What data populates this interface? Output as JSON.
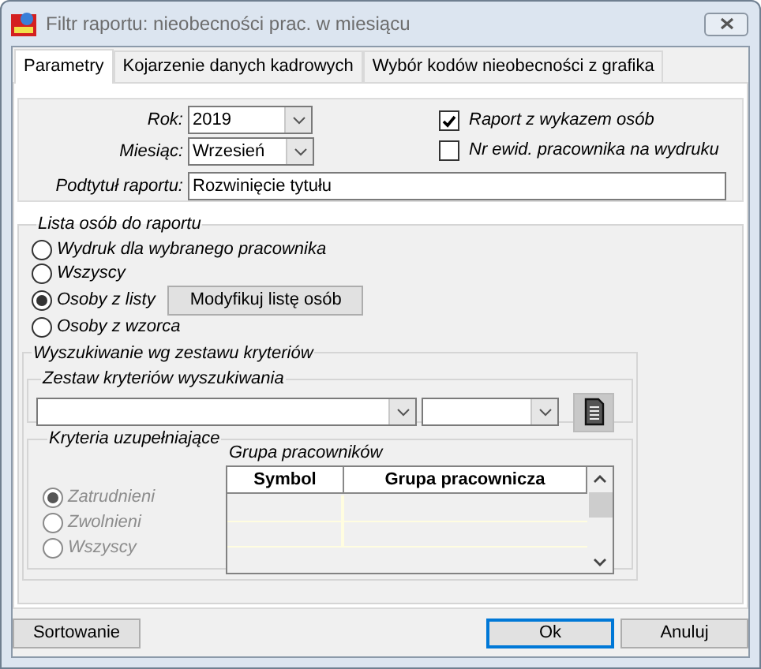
{
  "window": {
    "title": "Filtr raportu: nieobecności prac. w miesiącu"
  },
  "tabs": [
    {
      "label": "Parametry",
      "selected": true
    },
    {
      "label": "Kojarzenie danych kadrowych",
      "selected": false
    },
    {
      "label": "Wybór kodów nieobecności z grafika",
      "selected": false
    }
  ],
  "form": {
    "combos": [
      {
        "label": "Rok:",
        "value": "2019"
      },
      {
        "label": "Miesiąc:",
        "value": "Wrzesień"
      }
    ],
    "subtitle": {
      "label": "Podtytuł raportu:",
      "value": "Rozwinięcie tytułu"
    }
  },
  "options": [
    {
      "label": "Raport z wykazem osób",
      "checked": true
    },
    {
      "label": "Nr ewid. pracownika na wydruku",
      "checked": false
    }
  ],
  "person_list": {
    "title": "Lista osób do raportu",
    "choices": [
      {
        "label": "Wydruk dla wybranego pracownika",
        "selected": false
      },
      {
        "label": "Wszyscy",
        "selected": false
      },
      {
        "label": "Osoby z listy",
        "selected": true
      },
      {
        "label": "Osoby z wzorca",
        "selected": false
      }
    ],
    "modify_button": "Modyfikuj listę osób"
  },
  "search": {
    "title": "Wyszukiwanie wg zestawu kryteriów",
    "set_title": "Zestaw kryteriów wyszukiwania"
  },
  "supplementary": {
    "title": "Kryteria uzupełniające",
    "choices": [
      {
        "label": "Zatrudnieni",
        "selected": true,
        "disabled": true
      },
      {
        "label": "Zwolnieni",
        "selected": false,
        "disabled": true
      },
      {
        "label": "Wszyscy",
        "selected": false,
        "disabled": true
      }
    ],
    "group_title": "Grupa pracowników",
    "table": {
      "columns": [
        "Symbol",
        "Grupa pracownicza"
      ]
    }
  },
  "buttons_left": [
    {
      "label": "Sortowanie",
      "default": false
    }
  ],
  "buttons_right": [
    {
      "label": "Ok",
      "default": true
    },
    {
      "label": "Anuluj",
      "default": false
    }
  ]
}
